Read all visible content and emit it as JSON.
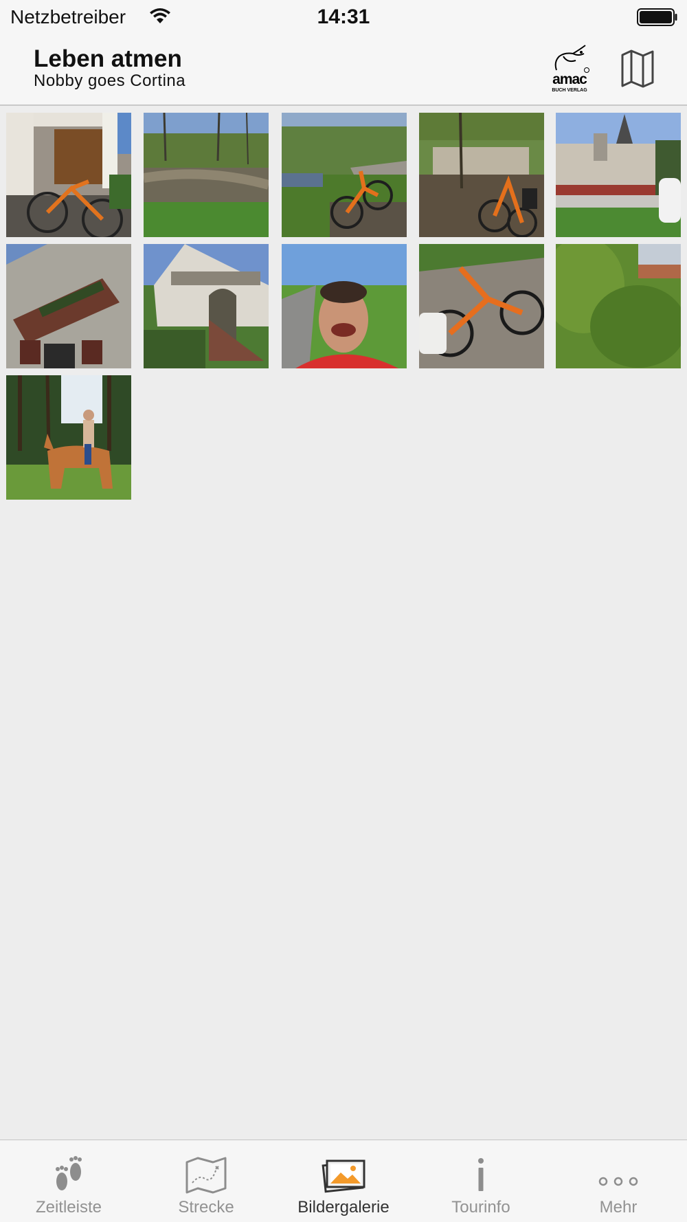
{
  "status_bar": {
    "carrier": "Netzbetreiber",
    "time": "14:31"
  },
  "nav": {
    "title": "Leben atmen",
    "subtitle": "Nobby goes Cortina",
    "brand_logo_text": "amac",
    "brand_logo_subtext": "BUCH VERLAG",
    "map_icon": "map-icon"
  },
  "gallery": {
    "photos": [
      {
        "subject": "bike-at-barn-door"
      },
      {
        "subject": "river-stream"
      },
      {
        "subject": "bike-by-path-river"
      },
      {
        "subject": "bike-at-riverbank"
      },
      {
        "subject": "castle-building"
      },
      {
        "subject": "house-facade-mural"
      },
      {
        "subject": "white-gate-stairs"
      },
      {
        "subject": "selfie-man-red-shirt"
      },
      {
        "subject": "bike-on-stone-patio"
      },
      {
        "subject": "green-shrubs"
      },
      {
        "subject": "horse-rider-forest"
      }
    ]
  },
  "tab_bar": {
    "active_index": 2,
    "active_color": "#f39a2b",
    "tabs": [
      {
        "label": "Zeitleiste",
        "icon": "footprints-icon"
      },
      {
        "label": "Strecke",
        "icon": "route-map-icon"
      },
      {
        "label": "Bildergalerie",
        "icon": "photo-gallery-icon"
      },
      {
        "label": "Tourinfo",
        "icon": "info-icon"
      },
      {
        "label": "Mehr",
        "icon": "more-dots-icon"
      }
    ]
  }
}
